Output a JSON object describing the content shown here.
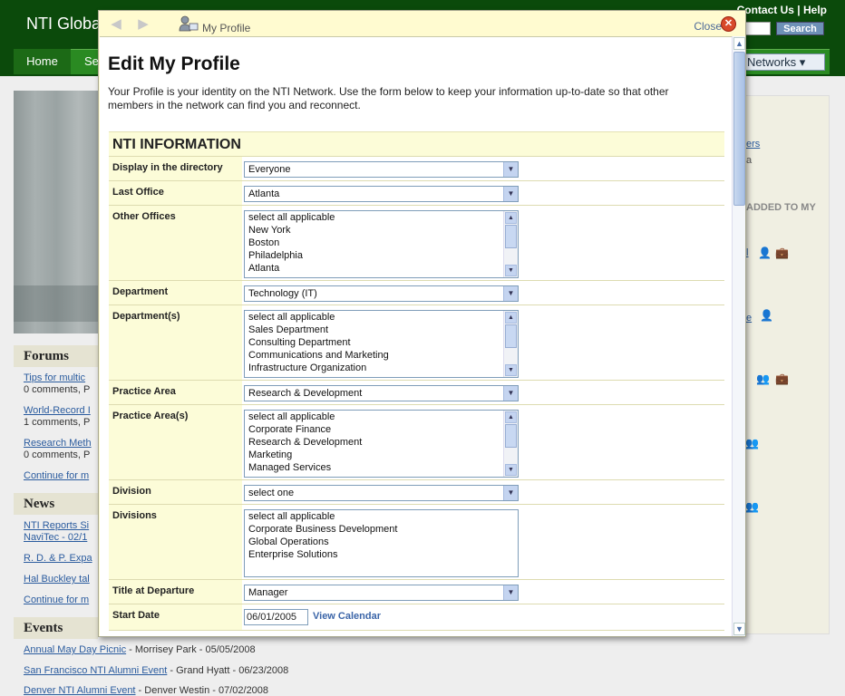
{
  "background": {
    "logo": "NTI Globa",
    "toplinks": {
      "contact": "Contact Us",
      "sep": "|",
      "help": "Help"
    },
    "search_button": "Search",
    "nav": {
      "home": "Home",
      "se": "Se",
      "networks": "Networks ▾"
    },
    "right_panel": {
      "t1": "ers",
      "t2": "a",
      "t3": "ADDED TO MY",
      "t4": "l",
      "t5": "e"
    },
    "forums": {
      "title": "Forums",
      "items": [
        {
          "link": "Tips for multic",
          "meta": "0 comments, P"
        },
        {
          "link": "World-Record I",
          "meta": "1 comments, P"
        },
        {
          "link": "Research Meth",
          "meta": "0 comments, P"
        }
      ],
      "continue": "Continue for m"
    },
    "news": {
      "title": "News",
      "items": [
        {
          "link": "NTI Reports Si",
          "meta": "NaviTec - 02/1"
        },
        {
          "link": "R. D. & P. Expa"
        },
        {
          "link": "Hal Buckley tal"
        }
      ],
      "continue": "Continue for m"
    },
    "events": {
      "title": "Events",
      "items": [
        {
          "link": "Annual May Day Picnic",
          "rest": " - Morrisey Park - 05/05/2008"
        },
        {
          "link": "San Francisco NTI Alumni Event",
          "rest": " - Grand Hyatt - 06/23/2008"
        },
        {
          "link": "Denver NTI Alumni Event",
          "rest": " - Denver Westin - 07/02/2008"
        }
      ]
    }
  },
  "modal": {
    "title": "My Profile",
    "close": "Close",
    "heading": "Edit My Profile",
    "intro": "Your Profile is your identity on the NTI Network. Use the form below to keep your information up-to-date so that other members in the network can find you and reconnect.",
    "section": "NTI INFORMATION",
    "fields": {
      "display": {
        "label": "Display in the directory",
        "value": "Everyone"
      },
      "last_office": {
        "label": "Last Office",
        "value": "Atlanta"
      },
      "other_offices": {
        "label": "Other Offices",
        "options": [
          "select all applicable",
          "New York",
          "Boston",
          "Philadelphia",
          "Atlanta"
        ]
      },
      "department": {
        "label": "Department",
        "value": "Technology (IT)"
      },
      "departments": {
        "label": "Department(s)",
        "options": [
          "select all applicable",
          "Sales Department",
          "Consulting Department",
          "Communications and Marketing",
          "Infrastructure Organization"
        ]
      },
      "practice_area": {
        "label": "Practice Area",
        "value": "Research & Development"
      },
      "practice_areas": {
        "label": "Practice Area(s)",
        "options": [
          "select all applicable",
          "Corporate Finance",
          "Research & Development",
          "Marketing",
          "Managed Services"
        ]
      },
      "division": {
        "label": "Division",
        "value": "select one"
      },
      "divisions": {
        "label": "Divisions",
        "options": [
          "select all applicable",
          "Corporate Business Development",
          "Global Operations",
          "Enterprise Solutions"
        ]
      },
      "title_departure": {
        "label": "Title at Departure",
        "value": "Manager"
      },
      "start_date": {
        "label": "Start Date",
        "value": "06/01/2005",
        "calendar": "View Calendar"
      }
    }
  }
}
